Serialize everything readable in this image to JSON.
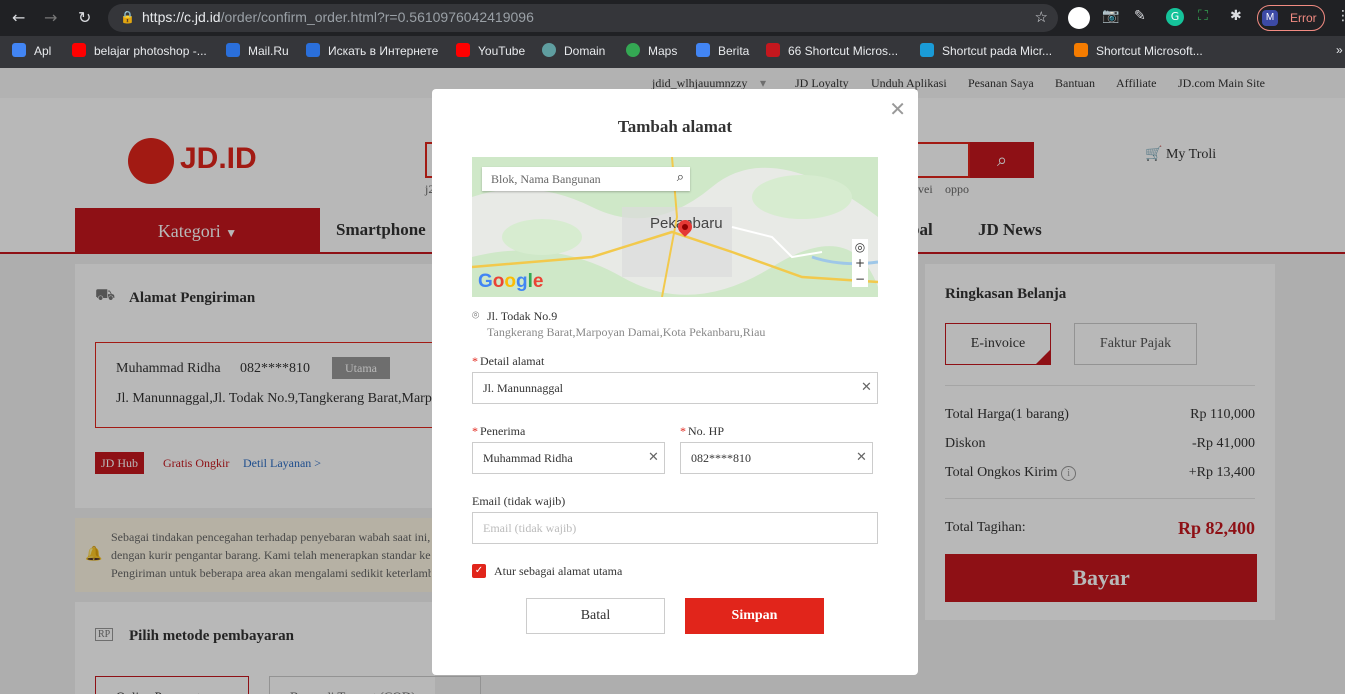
{
  "browser": {
    "url_domain": "https://c.jd.id",
    "url_path": "/order/confirm_order.html?r=0.5610976042419096",
    "error_label": "Error",
    "bookmarks": [
      {
        "label": "Apl",
        "color": "#4285f4"
      },
      {
        "label": "belajar photoshop -...",
        "color": "#ff0000"
      },
      {
        "label": "Mail.Ru",
        "color": "#2a6fdb"
      },
      {
        "label": "Искать в Интернете",
        "color": "#2a6fdb"
      },
      {
        "label": "YouTube",
        "color": "#ff0000"
      },
      {
        "label": "Domain",
        "color": "#5f9ea0"
      },
      {
        "label": "Maps",
        "color": "#34a853"
      },
      {
        "label": "Berita",
        "color": "#4285f4"
      },
      {
        "label": "66 Shortcut Micros...",
        "color": "#c5171e"
      },
      {
        "label": "Shortcut pada Micr...",
        "color": "#1a9bd7"
      },
      {
        "label": "Shortcut Microsoft...",
        "color": "#f57c00"
      }
    ],
    "more": "»"
  },
  "topnav": {
    "user": "jdid_wlhjauumnzzy",
    "links": [
      "JD Loyalty",
      "Unduh Aplikasi",
      "Pesanan Saya",
      "Bantuan",
      "Affiliate",
      "JD.com Main Site"
    ]
  },
  "header": {
    "logo": "JD.ID",
    "hot_left": "j2",
    "hot_right": [
      "vei",
      "oppo"
    ],
    "cart": "My Troli"
  },
  "catbar": {
    "kategori": "Kategori",
    "links": [
      "Smartphone",
      "bal",
      "JD News"
    ]
  },
  "shipping": {
    "title": "Alamat Pengiriman",
    "name": "Muhammad Ridha",
    "phone": "082****810",
    "badge": "Utama",
    "address": "Jl. Manunnaggal,Jl. Todak No.9,Tangkerang Barat,Marp",
    "tags": [
      "JD Hub",
      "Gratis Ongkir",
      "Detil Layanan >"
    ]
  },
  "notice": {
    "lines": [
      "Sebagai tindakan pencegahan terhadap penyebaran wabah saat ini,",
      "dengan kurir pengantar barang. Kami telah menerapkan standar ke",
      "Pengiriman untuk beberapa area akan mengalami sedikit keterlamb"
    ]
  },
  "payment": {
    "title": "Pilih metode pembayaran",
    "options": [
      "Online Payment",
      "Bayar di Tempat (COD)"
    ]
  },
  "summary": {
    "title": "Ringkasan Belanja",
    "invoice_options": [
      "E-invoice",
      "Faktur Pajak"
    ],
    "rows": [
      {
        "label": "Total Harga(1 barang)",
        "value": "Rp 110,000"
      },
      {
        "label": "Diskon",
        "value": "-Rp 41,000"
      },
      {
        "label": "Total Ongkos Kirim",
        "value": "+Rp 13,400"
      }
    ],
    "total_label": "Total Tagihan:",
    "total_value": "Rp 82,400",
    "pay_button": "Bayar"
  },
  "modal": {
    "title": "Tambah alamat",
    "map": {
      "search_placeholder": "Blok, Nama Bangunan",
      "city_label": "Pekanbaru",
      "brand": "Google"
    },
    "location": {
      "line1": "Jl. Todak No.9",
      "line2": "Tangkerang Barat,Marpoyan Damai,Kota Pekanbaru,Riau"
    },
    "fields": {
      "detail_label": "Detail alamat",
      "detail_value": "Jl. Manunnaggal",
      "recipient_label": "Penerima",
      "recipient_value": "Muhammad Ridha",
      "phone_label": "No. HP",
      "phone_value": "082****810",
      "email_label": "Email (tidak wajib)",
      "email_placeholder": "Email (tidak wajib)"
    },
    "checkbox_label": "Atur sebagai alamat utama",
    "cancel": "Batal",
    "save": "Simpan"
  }
}
